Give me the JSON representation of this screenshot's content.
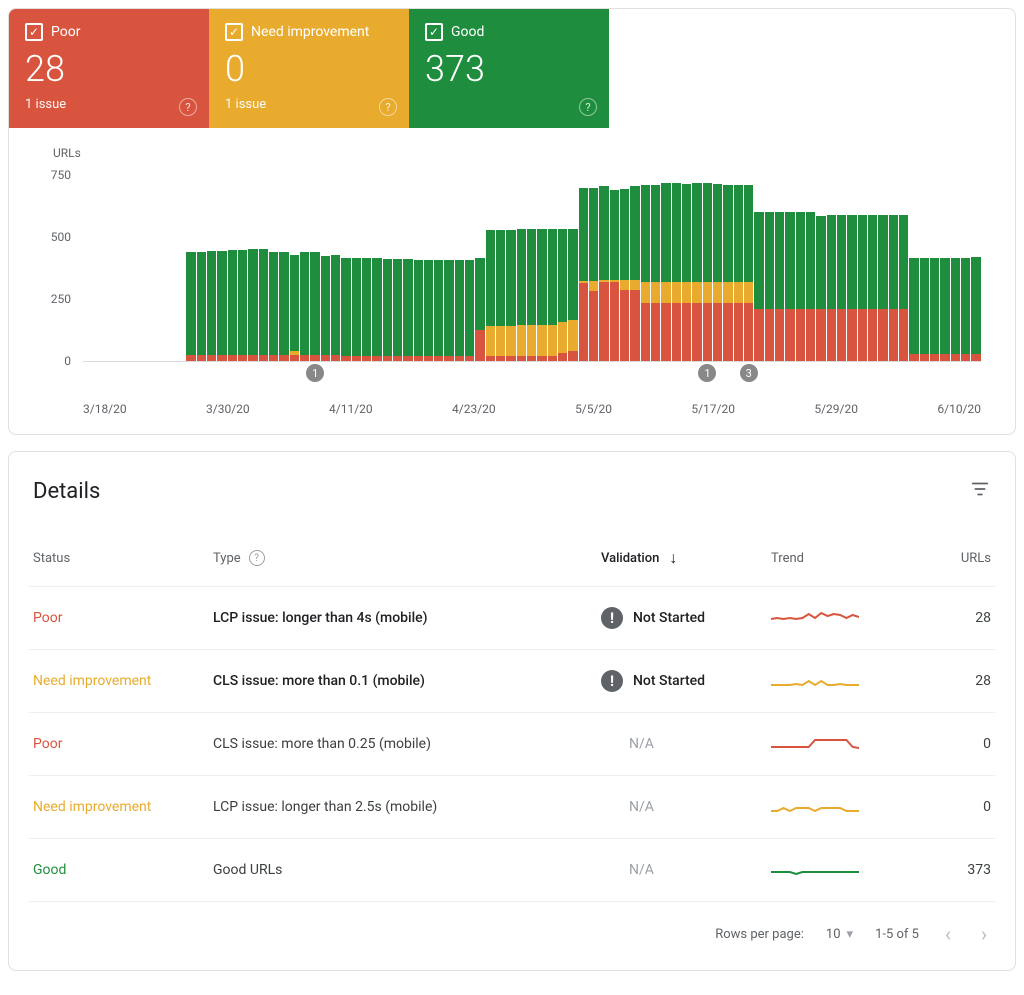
{
  "tiles": {
    "poor": {
      "label": "Poor",
      "value": "28",
      "issues": "1 issue"
    },
    "need": {
      "label": "Need improvement",
      "value": "0",
      "issues": "1 issue"
    },
    "good": {
      "label": "Good",
      "value": "373",
      "issues": ""
    }
  },
  "chart_data": {
    "type": "bar",
    "title": "",
    "ylabel": "URLs",
    "xlabel": "",
    "ylim": [
      0,
      750
    ],
    "yticks": [
      0,
      250,
      500,
      750
    ],
    "xticks": [
      "3/18/20",
      "3/30/20",
      "4/11/20",
      "4/23/20",
      "5/5/20",
      "5/17/20",
      "5/29/20",
      "6/10/20"
    ],
    "categories_start_index": 10,
    "series": [
      {
        "name": "Poor",
        "color": "#d9543e"
      },
      {
        "name": "Need improvement",
        "color": "#e8ab2d"
      },
      {
        "name": "Good",
        "color": "#1e8e3e"
      }
    ],
    "values": [
      {
        "poor": 25,
        "need": 0,
        "good": 395
      },
      {
        "poor": 25,
        "need": 0,
        "good": 395
      },
      {
        "poor": 25,
        "need": 0,
        "good": 400
      },
      {
        "poor": 25,
        "need": 0,
        "good": 400
      },
      {
        "poor": 25,
        "need": 0,
        "good": 405
      },
      {
        "poor": 25,
        "need": 0,
        "good": 405
      },
      {
        "poor": 25,
        "need": 0,
        "good": 408
      },
      {
        "poor": 25,
        "need": 0,
        "good": 408
      },
      {
        "poor": 25,
        "need": 0,
        "good": 395
      },
      {
        "poor": 25,
        "need": 0,
        "good": 395
      },
      {
        "poor": 25,
        "need": 15,
        "good": 370
      },
      {
        "poor": 25,
        "need": 0,
        "good": 395
      },
      {
        "poor": 25,
        "need": 0,
        "good": 395
      },
      {
        "poor": 25,
        "need": 0,
        "good": 380
      },
      {
        "poor": 25,
        "need": 0,
        "good": 385
      },
      {
        "poor": 20,
        "need": 0,
        "good": 380
      },
      {
        "poor": 20,
        "need": 0,
        "good": 380
      },
      {
        "poor": 20,
        "need": 0,
        "good": 380
      },
      {
        "poor": 20,
        "need": 0,
        "good": 380
      },
      {
        "poor": 20,
        "need": 0,
        "good": 375
      },
      {
        "poor": 20,
        "need": 0,
        "good": 375
      },
      {
        "poor": 20,
        "need": 0,
        "good": 375
      },
      {
        "poor": 20,
        "need": 0,
        "good": 370
      },
      {
        "poor": 20,
        "need": 0,
        "good": 370
      },
      {
        "poor": 20,
        "need": 0,
        "good": 370
      },
      {
        "poor": 20,
        "need": 0,
        "good": 370
      },
      {
        "poor": 20,
        "need": 0,
        "good": 370
      },
      {
        "poor": 20,
        "need": 0,
        "good": 370
      },
      {
        "poor": 120,
        "need": 0,
        "good": 280
      },
      {
        "poor": 20,
        "need": 115,
        "good": 370
      },
      {
        "poor": 20,
        "need": 115,
        "good": 370
      },
      {
        "poor": 20,
        "need": 115,
        "good": 370
      },
      {
        "poor": 20,
        "need": 120,
        "good": 370
      },
      {
        "poor": 20,
        "need": 120,
        "good": 370
      },
      {
        "poor": 20,
        "need": 120,
        "good": 370
      },
      {
        "poor": 20,
        "need": 120,
        "good": 370
      },
      {
        "poor": 30,
        "need": 120,
        "good": 360
      },
      {
        "poor": 40,
        "need": 120,
        "good": 350
      },
      {
        "poor": 300,
        "need": 10,
        "good": 360
      },
      {
        "poor": 270,
        "need": 40,
        "good": 360
      },
      {
        "poor": 305,
        "need": 10,
        "good": 360
      },
      {
        "poor": 305,
        "need": 10,
        "good": 345
      },
      {
        "poor": 275,
        "need": 40,
        "good": 350
      },
      {
        "poor": 275,
        "need": 40,
        "good": 360
      },
      {
        "poor": 225,
        "need": 80,
        "good": 375
      },
      {
        "poor": 225,
        "need": 80,
        "good": 375
      },
      {
        "poor": 225,
        "need": 80,
        "good": 385
      },
      {
        "poor": 225,
        "need": 80,
        "good": 385
      },
      {
        "poor": 225,
        "need": 80,
        "good": 380
      },
      {
        "poor": 225,
        "need": 80,
        "good": 385
      },
      {
        "poor": 225,
        "need": 80,
        "good": 385
      },
      {
        "poor": 225,
        "need": 80,
        "good": 380
      },
      {
        "poor": 225,
        "need": 80,
        "good": 375
      },
      {
        "poor": 225,
        "need": 80,
        "good": 375
      },
      {
        "poor": 225,
        "need": 80,
        "good": 375
      },
      {
        "poor": 200,
        "need": 0,
        "good": 375
      },
      {
        "poor": 200,
        "need": 0,
        "good": 375
      },
      {
        "poor": 200,
        "need": 0,
        "good": 375
      },
      {
        "poor": 200,
        "need": 0,
        "good": 375
      },
      {
        "poor": 200,
        "need": 0,
        "good": 375
      },
      {
        "poor": 200,
        "need": 0,
        "good": 375
      },
      {
        "poor": 200,
        "need": 0,
        "good": 360
      },
      {
        "poor": 200,
        "need": 0,
        "good": 365
      },
      {
        "poor": 200,
        "need": 0,
        "good": 365
      },
      {
        "poor": 200,
        "need": 0,
        "good": 365
      },
      {
        "poor": 200,
        "need": 0,
        "good": 365
      },
      {
        "poor": 200,
        "need": 0,
        "good": 365
      },
      {
        "poor": 200,
        "need": 0,
        "good": 365
      },
      {
        "poor": 200,
        "need": 0,
        "good": 365
      },
      {
        "poor": 200,
        "need": 0,
        "good": 365
      },
      {
        "poor": 28,
        "need": 0,
        "good": 370
      },
      {
        "poor": 28,
        "need": 0,
        "good": 370
      },
      {
        "poor": 28,
        "need": 0,
        "good": 370
      },
      {
        "poor": 28,
        "need": 0,
        "good": 370
      },
      {
        "poor": 28,
        "need": 0,
        "good": 370
      },
      {
        "poor": 28,
        "need": 0,
        "good": 370
      },
      {
        "poor": 28,
        "need": 0,
        "good": 373
      }
    ],
    "events": [
      {
        "rel_index": 12,
        "label": "1"
      },
      {
        "rel_index": 50,
        "label": "1"
      },
      {
        "rel_index": 54,
        "label": "3"
      }
    ]
  },
  "details": {
    "title": "Details",
    "columns": {
      "status": "Status",
      "type": "Type",
      "validation": "Validation",
      "trend": "Trend",
      "urls": "URLs"
    },
    "rows": [
      {
        "status": "Poor",
        "status_class": "poor",
        "type": "LCP issue: longer than 4s (mobile)",
        "type_bold": true,
        "validation": "Not Started",
        "urls": "28",
        "trend_color": "#d9543e",
        "trend": [
          8,
          9,
          8,
          9,
          8,
          9,
          13,
          9,
          14,
          11,
          13,
          12,
          9,
          12,
          10
        ]
      },
      {
        "status": "Need improvement",
        "status_class": "need",
        "type": "CLS issue: more than 0.1 (mobile)",
        "type_bold": true,
        "validation": "Not Started",
        "urls": "28",
        "trend_color": "#e8ab2d",
        "trend": [
          5,
          5,
          5,
          5,
          6,
          5,
          9,
          5,
          9,
          5,
          5,
          6,
          5,
          5,
          5
        ]
      },
      {
        "status": "Poor",
        "status_class": "poor",
        "type": "CLS issue: more than 0.25 (mobile)",
        "type_bold": false,
        "validation": "N/A",
        "urls": "0",
        "trend_color": "#d9543e",
        "trend": [
          6,
          6,
          6,
          6,
          6,
          6,
          6,
          13,
          13,
          13,
          13,
          13,
          13,
          6,
          5
        ]
      },
      {
        "status": "Need improvement",
        "status_class": "need",
        "type": "LCP issue: longer than 2.5s (mobile)",
        "type_bold": false,
        "validation": "N/A",
        "urls": "0",
        "trend_color": "#e8ab2d",
        "trend": [
          5,
          5,
          8,
          5,
          8,
          8,
          8,
          5,
          8,
          8,
          8,
          8,
          5,
          5,
          5
        ]
      },
      {
        "status": "Good",
        "status_class": "good",
        "type": "Good URLs",
        "type_bold": false,
        "validation": "N/A",
        "urls": "373",
        "trend_color": "#1e8e3e",
        "trend": [
          7,
          7,
          7,
          7,
          5,
          7,
          7,
          7,
          7,
          7,
          7,
          7,
          7,
          7,
          7
        ]
      }
    ]
  },
  "pagination": {
    "rows_per_page_label": "Rows per page:",
    "rows_per_page_value": "10",
    "range": "1-5 of 5"
  }
}
